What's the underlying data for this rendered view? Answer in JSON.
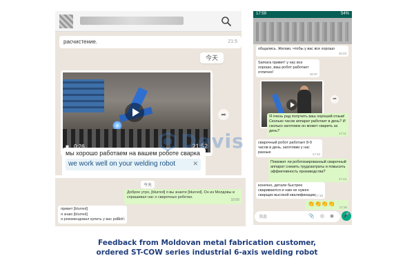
{
  "chat1": {
    "prev_message": "расчистение.",
    "prev_time": "21:5",
    "day_chip": "今天",
    "video": {
      "duration": "0:26",
      "time": "21:52"
    },
    "ru_message": "мы хорошо работаем на вашем роботе сварка",
    "translation": "we work well on your welding robot",
    "close_glyph": "✕"
  },
  "chat2": {
    "day": "今天",
    "out_message": "Доброе утро, [blurred] я вы знаете [blurred]. Он из Молдовы и спрашивал нас о сварочных роботах.",
    "out_time": "10:00",
    "in_lines": [
      "привет [blurred]",
      "я знаю [blurred]",
      "я рекомендовал купить у вас робот"
    ],
    "in_time": "10:16"
  },
  "phone": {
    "status_time": "17:59",
    "status_right": "54%",
    "messages": [
      {
        "side": "in",
        "text": "общались. Желаю, чтобы у вас все хорошо",
        "time": "16:23"
      },
      {
        "side": "in",
        "text": "Samara привет! у нас все хорошо, ваш робот работает отлично!",
        "time": "16:37"
      },
      {
        "side": "out",
        "text": "Я очень рад получить ваш хороший отзыв! Сколько часов аппарат работает в день? И сколько заготовок он может сварить за день?",
        "time": "17:11"
      },
      {
        "side": "in",
        "text": "сварочный робот работает 8-9 часов в день, заготовки у нас разные",
        "time": "17:12"
      },
      {
        "side": "out",
        "text": "Поможет ли роботизированный сварочный аппарат снизить трудозатраты и повысить эффективность производства?",
        "time": "17:14"
      },
      {
        "side": "in",
        "text": "конечно, детали быстрее свариваются и нам не нужен сварщик высокой квалификации",
        "time": "17:16"
      }
    ],
    "emoji": "👏👏👏👏",
    "emoji_time": "17:25",
    "composer_placeholder": "消息",
    "composer_icons": "📎 ◎ ◉",
    "mic_glyph": "🎤",
    "forward_glyph": "➦"
  },
  "watermark": "Devis",
  "caption": {
    "line1": "Feedback from Moldovan metal fabrication customer,",
    "line2": "ordered ST-COW series industrial 6-axis welding robot"
  },
  "colors": {
    "accent": "#1f3d7a",
    "bubble_out": "#dcf8c6",
    "chat_bg": "#ece5dd",
    "whatsapp_green": "#075e54"
  }
}
